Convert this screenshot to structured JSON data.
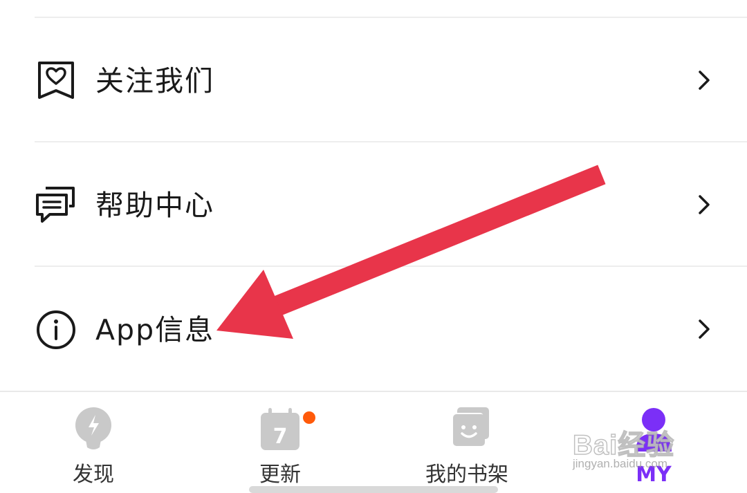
{
  "menu": {
    "items": [
      {
        "label": "关注我们",
        "icon": "heart-bookmark-icon"
      },
      {
        "label": "帮助中心",
        "icon": "chat-bubbles-icon"
      },
      {
        "label": "App信息",
        "icon": "info-circle-icon"
      }
    ],
    "chevron_icon": "chevron-right-icon"
  },
  "tabbar": {
    "tabs": [
      {
        "label": "发现",
        "icon": "lightbulb-icon",
        "active": false
      },
      {
        "label": "更新",
        "icon": "calendar-icon",
        "calendar_day": "7",
        "badge": true,
        "active": false
      },
      {
        "label": "我的书架",
        "icon": "bookshelf-smile-icon",
        "active": false
      },
      {
        "label": "MY",
        "icon": "user-icon",
        "active": true
      }
    ],
    "active_color": "#7b2ff7",
    "inactive_color": "#333333",
    "icon_gray": "#c9c9c9",
    "badge_color": "#ff5a0a"
  },
  "annotation": {
    "arrow_color": "#e8354a"
  },
  "watermark": {
    "brand": "Bai经验",
    "domain": "jingyan.baidu.com"
  }
}
